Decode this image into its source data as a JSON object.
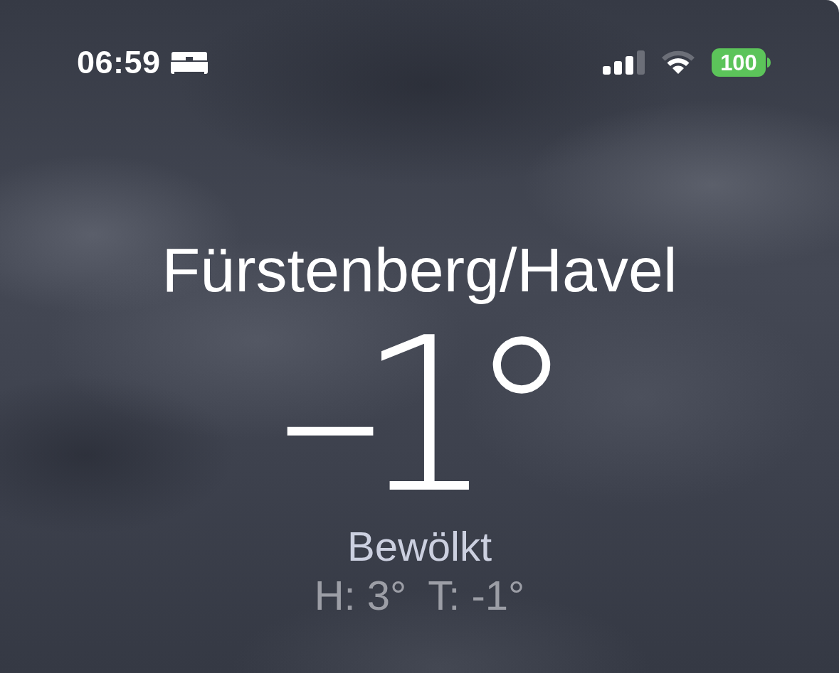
{
  "status_bar": {
    "time": "06:59",
    "battery": "100"
  },
  "weather": {
    "city": "Fürstenberg/Havel",
    "temperature": "–1°",
    "condition": "Bewölkt",
    "high": "H: 3°",
    "low": "T: -1°"
  }
}
